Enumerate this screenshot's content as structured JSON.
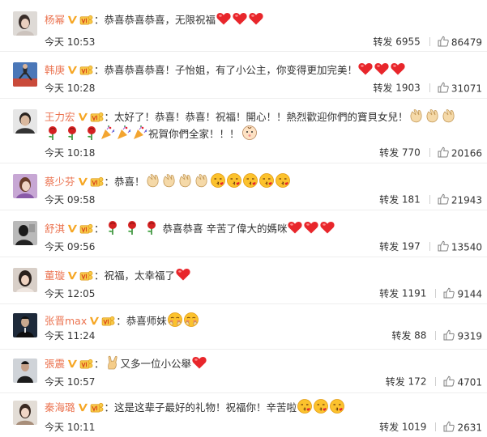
{
  "comments": [
    {
      "user": "杨幂",
      "text": "：恭喜恭喜恭喜，无限祝福",
      "time": "今天 10:53",
      "repost_label": "转发",
      "reposts": "6955",
      "likes": "86479",
      "emoji": [
        "heart",
        "heart",
        "heart"
      ]
    },
    {
      "user": "韩庚",
      "text": "：恭喜恭喜恭喜！子怡姐，有了小公主，你变得更加完美！",
      "time": "今天 10:28",
      "repost_label": "转发",
      "reposts": "1903",
      "likes": "31071",
      "emoji": [
        "heart",
        "heart",
        "heart"
      ]
    },
    {
      "user": "王力宏",
      "text": "：太好了！恭喜！恭喜！祝福！開心！！熱烈歡迎你們的寶貝女兒！",
      "text2": "祝賀你們全家！！！",
      "time": "今天 10:18",
      "repost_label": "转发",
      "reposts": "770",
      "likes": "20166",
      "emoji": [
        "clap",
        "clap",
        "clap"
      ],
      "emoji2a": [
        "rose",
        "rose",
        "rose",
        "party",
        "party",
        "party"
      ],
      "emoji2b": [
        "baby"
      ]
    },
    {
      "user": "蔡少芬",
      "text": "：恭喜！",
      "time": "今天 09:58",
      "repost_label": "转发",
      "reposts": "181",
      "likes": "21943",
      "emoji": [
        "clap",
        "clap",
        "clap",
        "clap",
        "kiss",
        "kiss",
        "kiss",
        "kiss",
        "kiss"
      ]
    },
    {
      "user": "舒淇",
      "text": "：",
      "text_b": "恭喜恭喜 辛苦了偉大的媽咪",
      "time": "今天 09:56",
      "repost_label": "转发",
      "reposts": "197",
      "likes": "13540",
      "emoji": [
        "rose",
        "rose",
        "rose"
      ],
      "emoji_b": [
        "heart",
        "heart",
        "heart"
      ]
    },
    {
      "user": "董璇",
      "text": "：祝福，太幸福了",
      "time": "今天 12:05",
      "repost_label": "转发",
      "reposts": "1191",
      "likes": "9144",
      "emoji": [
        "heart"
      ]
    },
    {
      "user": "张晋max",
      "text": "：恭喜师妹",
      "time": "今天 11:24",
      "repost_label": "转发",
      "reposts": "88",
      "likes": "9319",
      "emoji": [
        "shy",
        "shy"
      ]
    },
    {
      "user": "張震",
      "text": "：",
      "text_b": "又多一位小公舉",
      "time": "今天 10:57",
      "repost_label": "转发",
      "reposts": "172",
      "likes": "4701",
      "emoji": [
        "rock"
      ],
      "emoji_b": [
        "heart"
      ]
    },
    {
      "user": "秦海璐",
      "text": "：这是这辈子最好的礼物！祝福你！辛苦啦",
      "time": "今天 10:11",
      "repost_label": "转发",
      "reposts": "1019",
      "likes": "2631",
      "emoji": [
        "kiss",
        "kiss",
        "kiss"
      ]
    }
  ],
  "colors": {
    "username": "#eb7350",
    "vbadge": "#f6a623",
    "heart": "#e8262b"
  }
}
